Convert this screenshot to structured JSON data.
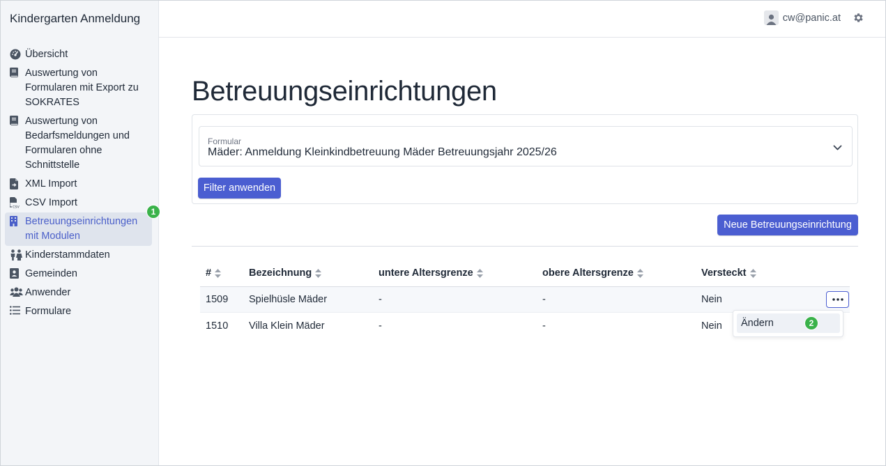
{
  "app": {
    "title": "Kindergarten Anmeldung"
  },
  "sidebar": {
    "items": [
      {
        "label": "Übersicht",
        "icon": "gauge-icon"
      },
      {
        "label": "Auswertung von Formularen mit Export zu SOKRATES",
        "icon": "book-icon"
      },
      {
        "label": "Auswertung von Bedarfsmeldungen und Formularen ohne Schnittstelle",
        "icon": "book-icon"
      },
      {
        "label": "XML Import",
        "icon": "file-import-icon"
      },
      {
        "label": "CSV Import",
        "icon": "file-csv-icon"
      },
      {
        "label": "Betreuungseinrichtungen mit Modulen",
        "icon": "building-icon",
        "active": true
      },
      {
        "label": "Kinderstammdaten",
        "icon": "children-icon"
      },
      {
        "label": "Gemeinden",
        "icon": "address-card-icon"
      },
      {
        "label": "Anwender",
        "icon": "users-icon"
      },
      {
        "label": "Formulare",
        "icon": "list-icon"
      }
    ],
    "active_badge": "1"
  },
  "topbar": {
    "user_email": "cw@panic.at"
  },
  "main": {
    "title": "Betreuungseinrichtungen",
    "filter": {
      "select_label": "Formular",
      "select_value": "Mäder: Anmeldung Kleinkindbetreuung Mäder Betreuungsjahr 2025/26",
      "apply_label": "Filter anwenden"
    },
    "new_button_label": "Neue Betreuungseinrichtung",
    "table": {
      "columns": [
        "#",
        "Bezeichnung",
        "untere Altersgrenze",
        "obere Altersgrenze",
        "Versteckt"
      ],
      "rows": [
        {
          "id": "1509",
          "name": "Spielhüsle Mäder",
          "lower": "-",
          "upper": "-",
          "hidden": "Nein"
        },
        {
          "id": "1510",
          "name": "Villa Klein Mäder",
          "lower": "-",
          "upper": "-",
          "hidden": "Nein"
        }
      ]
    },
    "row_menu": {
      "item_label": "Ändern",
      "badge": "2"
    }
  },
  "colors": {
    "accent": "#4b5ed1",
    "sidebar_bg": "#f3f5f8",
    "active_text": "#4a5fc9",
    "badge": "#3ab24a"
  }
}
